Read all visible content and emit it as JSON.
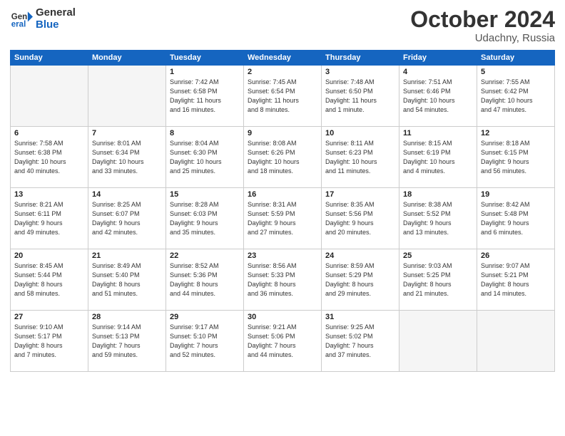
{
  "header": {
    "logo_general": "General",
    "logo_blue": "Blue",
    "month_title": "October 2024",
    "location": "Udachny, Russia"
  },
  "weekdays": [
    "Sunday",
    "Monday",
    "Tuesday",
    "Wednesday",
    "Thursday",
    "Friday",
    "Saturday"
  ],
  "weeks": [
    [
      {
        "day": "",
        "text": ""
      },
      {
        "day": "",
        "text": ""
      },
      {
        "day": "1",
        "text": "Sunrise: 7:42 AM\nSunset: 6:58 PM\nDaylight: 11 hours\nand 16 minutes."
      },
      {
        "day": "2",
        "text": "Sunrise: 7:45 AM\nSunset: 6:54 PM\nDaylight: 11 hours\nand 8 minutes."
      },
      {
        "day": "3",
        "text": "Sunrise: 7:48 AM\nSunset: 6:50 PM\nDaylight: 11 hours\nand 1 minute."
      },
      {
        "day": "4",
        "text": "Sunrise: 7:51 AM\nSunset: 6:46 PM\nDaylight: 10 hours\nand 54 minutes."
      },
      {
        "day": "5",
        "text": "Sunrise: 7:55 AM\nSunset: 6:42 PM\nDaylight: 10 hours\nand 47 minutes."
      }
    ],
    [
      {
        "day": "6",
        "text": "Sunrise: 7:58 AM\nSunset: 6:38 PM\nDaylight: 10 hours\nand 40 minutes."
      },
      {
        "day": "7",
        "text": "Sunrise: 8:01 AM\nSunset: 6:34 PM\nDaylight: 10 hours\nand 33 minutes."
      },
      {
        "day": "8",
        "text": "Sunrise: 8:04 AM\nSunset: 6:30 PM\nDaylight: 10 hours\nand 25 minutes."
      },
      {
        "day": "9",
        "text": "Sunrise: 8:08 AM\nSunset: 6:26 PM\nDaylight: 10 hours\nand 18 minutes."
      },
      {
        "day": "10",
        "text": "Sunrise: 8:11 AM\nSunset: 6:23 PM\nDaylight: 10 hours\nand 11 minutes."
      },
      {
        "day": "11",
        "text": "Sunrise: 8:15 AM\nSunset: 6:19 PM\nDaylight: 10 hours\nand 4 minutes."
      },
      {
        "day": "12",
        "text": "Sunrise: 8:18 AM\nSunset: 6:15 PM\nDaylight: 9 hours\nand 56 minutes."
      }
    ],
    [
      {
        "day": "13",
        "text": "Sunrise: 8:21 AM\nSunset: 6:11 PM\nDaylight: 9 hours\nand 49 minutes."
      },
      {
        "day": "14",
        "text": "Sunrise: 8:25 AM\nSunset: 6:07 PM\nDaylight: 9 hours\nand 42 minutes."
      },
      {
        "day": "15",
        "text": "Sunrise: 8:28 AM\nSunset: 6:03 PM\nDaylight: 9 hours\nand 35 minutes."
      },
      {
        "day": "16",
        "text": "Sunrise: 8:31 AM\nSunset: 5:59 PM\nDaylight: 9 hours\nand 27 minutes."
      },
      {
        "day": "17",
        "text": "Sunrise: 8:35 AM\nSunset: 5:56 PM\nDaylight: 9 hours\nand 20 minutes."
      },
      {
        "day": "18",
        "text": "Sunrise: 8:38 AM\nSunset: 5:52 PM\nDaylight: 9 hours\nand 13 minutes."
      },
      {
        "day": "19",
        "text": "Sunrise: 8:42 AM\nSunset: 5:48 PM\nDaylight: 9 hours\nand 6 minutes."
      }
    ],
    [
      {
        "day": "20",
        "text": "Sunrise: 8:45 AM\nSunset: 5:44 PM\nDaylight: 8 hours\nand 58 minutes."
      },
      {
        "day": "21",
        "text": "Sunrise: 8:49 AM\nSunset: 5:40 PM\nDaylight: 8 hours\nand 51 minutes."
      },
      {
        "day": "22",
        "text": "Sunrise: 8:52 AM\nSunset: 5:36 PM\nDaylight: 8 hours\nand 44 minutes."
      },
      {
        "day": "23",
        "text": "Sunrise: 8:56 AM\nSunset: 5:33 PM\nDaylight: 8 hours\nand 36 minutes."
      },
      {
        "day": "24",
        "text": "Sunrise: 8:59 AM\nSunset: 5:29 PM\nDaylight: 8 hours\nand 29 minutes."
      },
      {
        "day": "25",
        "text": "Sunrise: 9:03 AM\nSunset: 5:25 PM\nDaylight: 8 hours\nand 21 minutes."
      },
      {
        "day": "26",
        "text": "Sunrise: 9:07 AM\nSunset: 5:21 PM\nDaylight: 8 hours\nand 14 minutes."
      }
    ],
    [
      {
        "day": "27",
        "text": "Sunrise: 9:10 AM\nSunset: 5:17 PM\nDaylight: 8 hours\nand 7 minutes."
      },
      {
        "day": "28",
        "text": "Sunrise: 9:14 AM\nSunset: 5:13 PM\nDaylight: 7 hours\nand 59 minutes."
      },
      {
        "day": "29",
        "text": "Sunrise: 9:17 AM\nSunset: 5:10 PM\nDaylight: 7 hours\nand 52 minutes."
      },
      {
        "day": "30",
        "text": "Sunrise: 9:21 AM\nSunset: 5:06 PM\nDaylight: 7 hours\nand 44 minutes."
      },
      {
        "day": "31",
        "text": "Sunrise: 9:25 AM\nSunset: 5:02 PM\nDaylight: 7 hours\nand 37 minutes."
      },
      {
        "day": "",
        "text": ""
      },
      {
        "day": "",
        "text": ""
      }
    ]
  ]
}
